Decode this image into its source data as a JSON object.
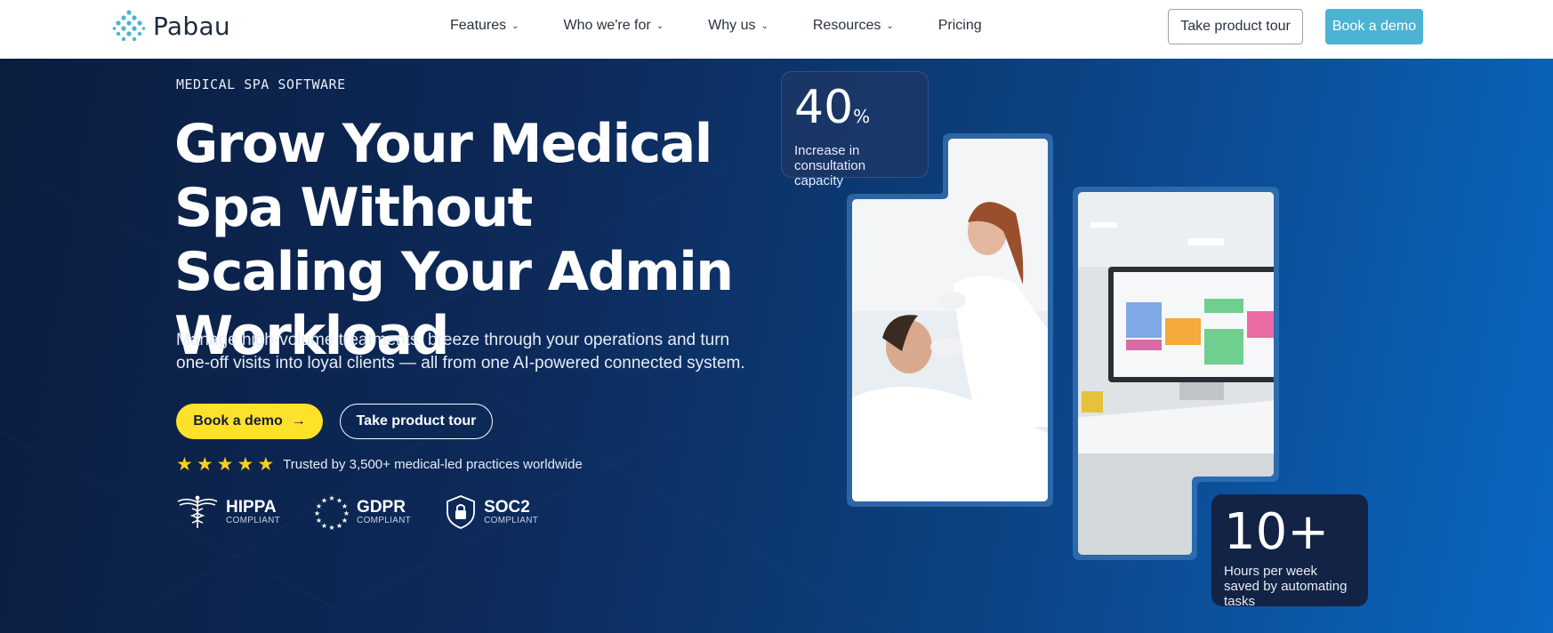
{
  "brand": {
    "name": "Pabau",
    "accent": "#4db3d3"
  },
  "nav": {
    "items": [
      {
        "label": "Features",
        "dropdown": true
      },
      {
        "label": "Who we're for",
        "dropdown": true
      },
      {
        "label": "Why us",
        "dropdown": true
      },
      {
        "label": "Resources",
        "dropdown": true
      },
      {
        "label": "Pricing",
        "dropdown": false
      }
    ],
    "tour_label": "Take product tour",
    "demo_label": "Book a demo"
  },
  "hero": {
    "eyebrow": "MEDICAL SPA SOFTWARE",
    "headline": "Grow Your Medical Spa Without Scaling Your Admin Workload",
    "subtext": "Manage high-volume treatments, breeze through your operations and turn one-off visits into loyal clients — all from one AI-powered connected system.",
    "cta_primary": "Book a demo",
    "cta_secondary": "Take product tour",
    "rating_stars": 5,
    "rating_text": "Trusted by 3,500+ medical-led practices worldwide",
    "badges": [
      {
        "title": "HIPPA",
        "sub": "COMPLIANT",
        "icon": "caduceus-icon"
      },
      {
        "title": "GDPR",
        "sub": "COMPLIANT",
        "icon": "eu-stars-icon"
      },
      {
        "title": "SOC2",
        "sub": "COMPLIANT",
        "icon": "shield-lock-icon"
      }
    ]
  },
  "stats": {
    "top": {
      "value": "40",
      "unit": "%",
      "caption": "Increase in consultation capacity"
    },
    "bottom": {
      "value": "10+",
      "caption": "Hours per week saved by automating tasks"
    }
  },
  "colors": {
    "yellow": "#fde22a",
    "star": "#fdcf1c",
    "nav_bg": "#ffffff"
  }
}
